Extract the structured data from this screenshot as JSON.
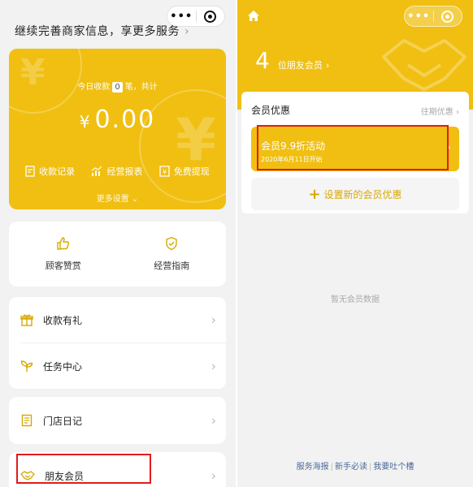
{
  "left": {
    "capsule": {
      "more": "•••"
    },
    "merchant_info": "继续完善商家信息，享更多服务",
    "today": {
      "prefix": "今日收款",
      "count": "0",
      "suffix": "笔，共计"
    },
    "amount": {
      "symbol": "¥",
      "value": "0.00"
    },
    "actions": [
      {
        "label": "收款记录",
        "icon": "receipt-icon"
      },
      {
        "label": "经营报表",
        "icon": "chart-icon"
      },
      {
        "label": "免费提现",
        "icon": "withdraw-icon"
      }
    ],
    "more_settings": "更多设置",
    "quick": [
      {
        "label": "顾客赞赏",
        "icon": "thumbs-up-icon"
      },
      {
        "label": "经营指南",
        "icon": "shield-check-icon"
      }
    ],
    "rows": [
      {
        "label": "收款有礼",
        "icon": "gift-icon"
      },
      {
        "label": "任务中心",
        "icon": "sprout-icon"
      },
      {
        "label": "门店日记",
        "icon": "notebook-icon"
      },
      {
        "label": "朋友会员",
        "icon": "handshake-icon"
      }
    ]
  },
  "right": {
    "capsule": {
      "more": "•••"
    },
    "member_count": "4",
    "member_unit": "位朋友会员",
    "benefit_title": "会员优惠",
    "past_link": "往期优惠",
    "promo": {
      "title": "会员9.9折活动",
      "date": "2020年6月11日开始"
    },
    "add_promo": "设置新的会员优惠",
    "empty": "暂无会员数据",
    "footer": [
      "服务海报",
      "新手必读",
      "我要吐个槽"
    ]
  },
  "colors": {
    "brand_yellow": "#f0bf11",
    "highlight_red": "#e31b1b"
  }
}
